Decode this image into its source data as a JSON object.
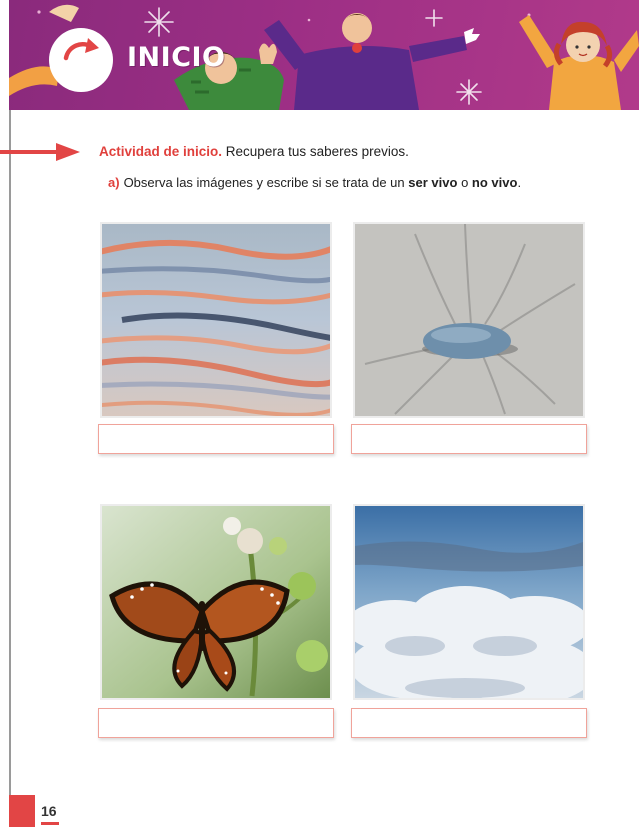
{
  "banner": {
    "title": "INICIO",
    "colors": {
      "background": "#9d2f85",
      "accent": "#e24545"
    }
  },
  "activity": {
    "lead": "Actividad de inicio.",
    "text": "Recupera tus saberes previos."
  },
  "question": {
    "letter": "a)",
    "text_before": "Observa las imágenes y escribe si se trata de un",
    "term_alive": "ser vivo",
    "connector": "o",
    "term_not_alive": "no vivo",
    "end": "."
  },
  "photos": [
    {
      "subject": "water-surface-reflection"
    },
    {
      "subject": "pebble-on-sand"
    },
    {
      "subject": "butterfly-on-flowers"
    },
    {
      "subject": "clouds-sky"
    }
  ],
  "answers": [
    "",
    "",
    "",
    ""
  ],
  "footer": {
    "page_number": "16"
  }
}
